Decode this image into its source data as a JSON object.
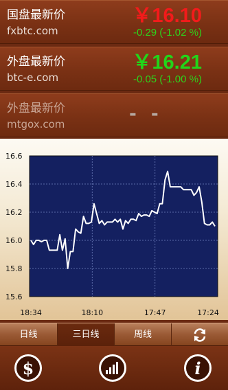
{
  "quotes": [
    {
      "name": "国盘最新价",
      "site": "fxbtc.com",
      "price": "￥16.10",
      "change": "-0.29 (-1.02 %)",
      "price_color": "#f21b1b",
      "change_color": "#2ed21c"
    },
    {
      "name": "外盘最新价",
      "site": "btc-e.com",
      "price": "￥16.21",
      "change": "-0.05 (-1.00 %)",
      "price_color": "#22d51a",
      "change_color": "#2ed21c"
    },
    {
      "name": "外盘最新价",
      "site": "mtgox.com",
      "price": "- -"
    }
  ],
  "chart_data": {
    "type": "line",
    "ylim": [
      15.6,
      16.6
    ],
    "yticks": [
      "16.6",
      "16.4",
      "16.2",
      "16.0",
      "15.8",
      "15.6"
    ],
    "xticks": [
      "18:34",
      "18:10",
      "17:47",
      "17:24"
    ],
    "x": [
      0,
      1,
      2,
      3,
      4,
      5,
      6,
      7,
      8,
      9,
      10,
      11,
      12,
      13,
      14,
      15,
      16,
      17,
      18,
      19,
      20,
      21,
      22,
      23,
      24,
      25,
      26,
      27,
      28,
      29,
      30,
      31,
      32,
      33,
      34,
      35,
      36,
      37,
      38,
      39,
      40,
      41,
      42,
      43,
      44,
      45,
      46,
      47,
      48,
      49,
      50,
      51,
      52,
      53,
      54,
      55,
      56,
      57,
      58,
      59,
      60,
      61,
      62,
      63,
      64,
      65,
      66,
      67,
      68,
      69,
      70
    ],
    "values": [
      16.0,
      15.97,
      16.0,
      16.0,
      15.99,
      16.0,
      16.0,
      15.93,
      15.93,
      15.93,
      15.93,
      16.04,
      15.93,
      16.01,
      15.8,
      15.92,
      15.92,
      16.08,
      16.06,
      16.05,
      16.17,
      16.12,
      16.12,
      16.13,
      16.26,
      16.19,
      16.12,
      16.14,
      16.11,
      16.13,
      16.13,
      16.13,
      16.15,
      16.13,
      16.15,
      16.08,
      16.14,
      16.12,
      16.15,
      16.15,
      16.14,
      16.19,
      16.17,
      16.18,
      16.18,
      16.17,
      16.21,
      16.2,
      16.19,
      16.26,
      16.26,
      16.43,
      16.49,
      16.38,
      16.38,
      16.38,
      16.38,
      16.38,
      16.36,
      16.36,
      16.36,
      16.36,
      16.32,
      16.34,
      16.38,
      16.27,
      16.12,
      16.11,
      16.11,
      16.13,
      16.1
    ],
    "line_color": "#ffffff",
    "plot_background": "#142060"
  },
  "tabs": [
    {
      "label": "日线",
      "active": false
    },
    {
      "label": "三日线",
      "active": true
    },
    {
      "label": "周线",
      "active": false
    },
    {
      "label": "",
      "icon": "refresh-icon",
      "active": false
    }
  ],
  "bottom_icons": [
    "dollar-icon",
    "signal-bars-icon",
    "info-icon"
  ]
}
